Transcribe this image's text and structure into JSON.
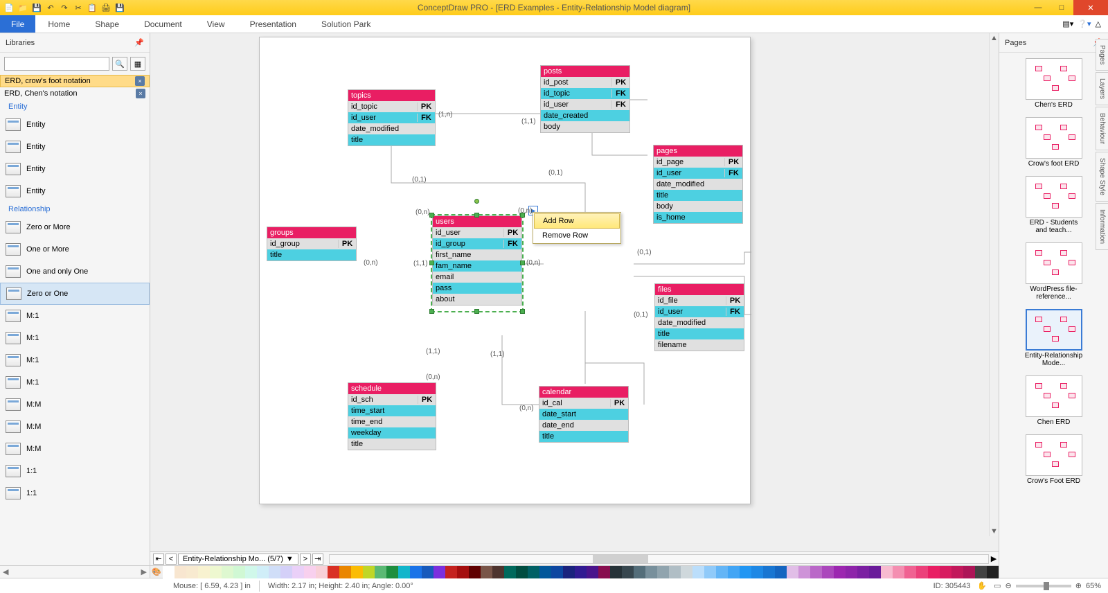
{
  "title": "ConceptDraw PRO - [ERD Examples - Entity-Relationship Model diagram]",
  "ribbon": {
    "file": "File",
    "tabs": [
      "Home",
      "Shape",
      "Document",
      "View",
      "Presentation",
      "Solution Park"
    ]
  },
  "libraries": {
    "title": "Libraries",
    "tags": [
      {
        "label": "ERD, crow's foot notation",
        "active": true
      },
      {
        "label": "ERD, Chen's notation",
        "active": false
      }
    ],
    "sections": {
      "entity": {
        "title": "Entity",
        "items": [
          "Entity",
          "Entity",
          "Entity",
          "Entity"
        ]
      },
      "relationship": {
        "title": "Relationship",
        "items": [
          "Zero or More",
          "One or More",
          "One and only One",
          "Zero or One",
          "M:1",
          "M:1",
          "M:1",
          "M:1",
          "M:M",
          "M:M",
          "M:M",
          "1:1",
          "1:1"
        ],
        "selected": 3
      }
    }
  },
  "context_menu": {
    "items": [
      "Add Row",
      "Remove Row"
    ],
    "highlighted": 0
  },
  "entities": {
    "topics": {
      "name": "topics",
      "rows": [
        [
          "id_topic",
          "PK",
          "gray"
        ],
        [
          "id_user",
          "FK",
          "teal"
        ],
        [
          "date_modified",
          "",
          "gray"
        ],
        [
          "title",
          "",
          "teal"
        ]
      ]
    },
    "posts": {
      "name": "posts",
      "rows": [
        [
          "id_post",
          "PK",
          "gray"
        ],
        [
          "id_topic",
          "FK",
          "teal"
        ],
        [
          "id_user",
          "FK",
          "gray"
        ],
        [
          "date_created",
          "",
          "teal"
        ],
        [
          "body",
          "",
          "gray"
        ]
      ]
    },
    "pages": {
      "name": "pages",
      "rows": [
        [
          "id_page",
          "PK",
          "gray"
        ],
        [
          "id_user",
          "FK",
          "teal"
        ],
        [
          "date_modified",
          "",
          "gray"
        ],
        [
          "title",
          "",
          "teal"
        ],
        [
          "body",
          "",
          "gray"
        ],
        [
          "is_home",
          "",
          "teal"
        ]
      ]
    },
    "groups": {
      "name": "groups",
      "rows": [
        [
          "id_group",
          "PK",
          "gray"
        ],
        [
          "title",
          "",
          "teal"
        ]
      ]
    },
    "users": {
      "name": "users",
      "rows": [
        [
          "id_user",
          "PK",
          "gray"
        ],
        [
          "id_group",
          "FK",
          "teal"
        ],
        [
          "first_name",
          "",
          "gray"
        ],
        [
          "fam_name",
          "",
          "teal"
        ],
        [
          "email",
          "",
          "gray"
        ],
        [
          "pass",
          "",
          "teal"
        ],
        [
          "about",
          "",
          "gray"
        ]
      ]
    },
    "files": {
      "name": "files",
      "rows": [
        [
          "id_file",
          "PK",
          "gray"
        ],
        [
          "id_user",
          "FK",
          "teal"
        ],
        [
          "date_modified",
          "",
          "gray"
        ],
        [
          "title",
          "",
          "teal"
        ],
        [
          "filename",
          "",
          "gray"
        ]
      ]
    },
    "schedule": {
      "name": "schedule",
      "rows": [
        [
          "id_sch",
          "PK",
          "gray"
        ],
        [
          "time_start",
          "",
          "teal"
        ],
        [
          "time_end",
          "",
          "gray"
        ],
        [
          "weekday",
          "",
          "teal"
        ],
        [
          "title",
          "",
          "gray"
        ]
      ]
    },
    "calendar": {
      "name": "calendar",
      "rows": [
        [
          "id_cal",
          "PK",
          "gray"
        ],
        [
          "date_start",
          "",
          "teal"
        ],
        [
          "date_end",
          "",
          "gray"
        ],
        [
          "title",
          "",
          "teal"
        ]
      ]
    }
  },
  "cardinalities": {
    "c1": "(1,n)",
    "c2": "(1,1)",
    "c3": "(0,1)",
    "c4": "(0,1)",
    "c5": "(0,n)",
    "c6": "(0,n)",
    "c7": "(1,1)",
    "c8": "(0,n)",
    "c9": "(0,1)",
    "c10": "(0,1)",
    "c11": "(1,1)",
    "c12": "(1,1)",
    "c13": "(0,n)",
    "c14": "(0,n)",
    "c15": "(0,n)"
  },
  "pages_panel": {
    "title": "Pages",
    "thumbs": [
      "Chen's ERD",
      "Crow's foot ERD",
      "ERD - Students and teach...",
      "WordPress file-reference...",
      "Entity-Relationship Mode...",
      "Chen ERD",
      "Crow's Foot ERD"
    ],
    "selected": 4
  },
  "side_tabs": [
    "Pages",
    "Layers",
    "Behaviour",
    "Shape Style",
    "Information"
  ],
  "page_tab": {
    "name": "Entity-Relationship Mo... (5/7)"
  },
  "status": {
    "mouse": "Mouse: [ 6.59, 4.23 ] in",
    "dims": "Width: 2.17 in;  Height: 2.40 in;  Angle: 0.00°",
    "id": "ID: 305443",
    "zoom": "65%"
  },
  "colors": [
    "#ffffff",
    "#f8e6d0",
    "#f8ead0",
    "#f8f2d0",
    "#eef8d0",
    "#def8d0",
    "#d0f8d4",
    "#d0f8ea",
    "#d0eef8",
    "#d0def8",
    "#d4d0f8",
    "#ead0f8",
    "#f8d0ee",
    "#f8d0d8",
    "#d93025",
    "#ea8600",
    "#fbbc04",
    "#c0d627",
    "#5bb974",
    "#1e8e3e",
    "#12b5cb",
    "#1a73e8",
    "#185abc",
    "#7b2fde",
    "#c5221f",
    "#a50e0e",
    "#600000",
    "#795548",
    "#4e342e",
    "#00695c",
    "#004d40",
    "#006064",
    "#01579b",
    "#0d47a1",
    "#1a237e",
    "#311b92",
    "#4a148c",
    "#880e4f",
    "#263238",
    "#37474f",
    "#546e7a",
    "#78909c",
    "#90a4ae",
    "#b0bec5",
    "#cfd8dc",
    "#bbdefb",
    "#90caf9",
    "#64b5f6",
    "#42a5f5",
    "#2196f3",
    "#1e88e5",
    "#1976d2",
    "#1565c0",
    "#e1bee7",
    "#ce93d8",
    "#ba68c8",
    "#ab47bc",
    "#9c27b0",
    "#8e24aa",
    "#7b1fa2",
    "#6a1b9a",
    "#f8bbd0",
    "#f48fb1",
    "#f06292",
    "#ec407a",
    "#e91e63",
    "#d81b60",
    "#c2185b",
    "#ad1457",
    "#424242",
    "#212121"
  ]
}
